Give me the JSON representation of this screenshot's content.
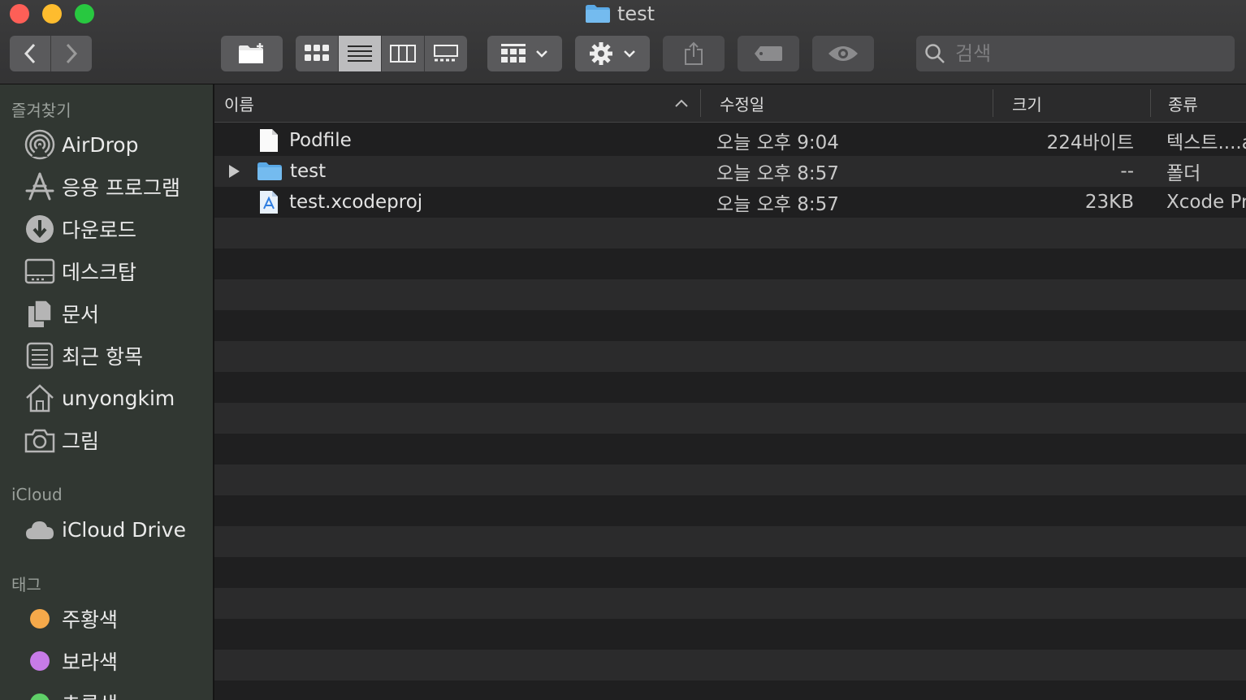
{
  "window": {
    "title": "test"
  },
  "toolbar": {
    "search_placeholder": "검색"
  },
  "sidebar": {
    "favorites_header": "즐겨찾기",
    "favorites": [
      {
        "label": "AirDrop",
        "icon": "airdrop-icon"
      },
      {
        "label": "응용 프로그램",
        "icon": "applications-icon"
      },
      {
        "label": "다운로드",
        "icon": "downloads-icon"
      },
      {
        "label": "데스크탑",
        "icon": "desktop-icon"
      },
      {
        "label": "문서",
        "icon": "documents-icon"
      },
      {
        "label": "최근 항목",
        "icon": "recents-icon"
      },
      {
        "label": "unyongkim",
        "icon": "home-icon"
      },
      {
        "label": "그림",
        "icon": "pictures-icon"
      }
    ],
    "icloud_header": "iCloud",
    "icloud": [
      {
        "label": "iCloud Drive",
        "icon": "cloud-icon"
      }
    ],
    "tags_header": "태그",
    "tags": [
      {
        "label": "주황색",
        "color": "#f5a94a"
      },
      {
        "label": "보라색",
        "color": "#c77be8"
      },
      {
        "label": "초록색",
        "color": "#5fd068"
      }
    ]
  },
  "columns": {
    "name": "이름",
    "modified": "수정일",
    "size": "크기",
    "kind": "종류"
  },
  "files": [
    {
      "name": "Podfile",
      "modified": "오늘 오후 9:04",
      "size": "224바이트",
      "kind": "텍스트....a",
      "icon": "document-icon",
      "expandable": false
    },
    {
      "name": "test",
      "modified": "오늘 오후 8:57",
      "size": "--",
      "kind": "폴더",
      "icon": "folder-icon",
      "expandable": true
    },
    {
      "name": "test.xcodeproj",
      "modified": "오늘 오후 8:57",
      "size": "23KB",
      "kind": "Xcode Pr",
      "icon": "xcodeproj-icon",
      "expandable": false
    }
  ],
  "colors": {
    "accent_folder": "#5aa9e6",
    "sidebar_bg": "#313732"
  }
}
